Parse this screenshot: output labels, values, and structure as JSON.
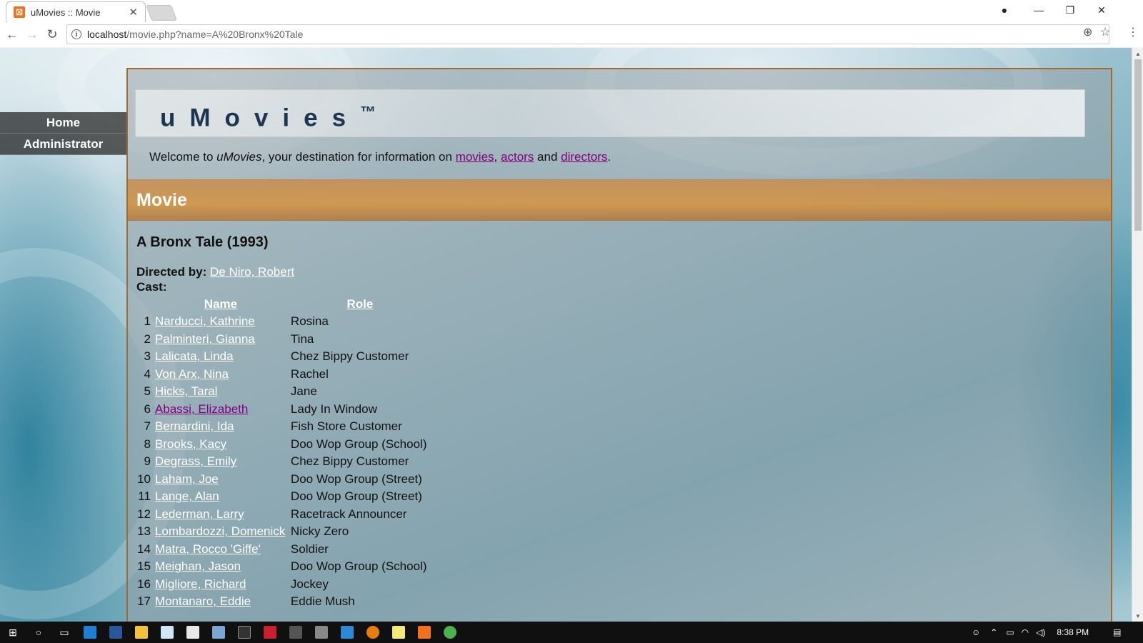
{
  "browser": {
    "tab_title": "uMovies :: Movie",
    "tab_favicon": "xampp-icon",
    "url_host": "localhost",
    "url_path": "/movie.php?name=A%20Bronx%20Tale"
  },
  "sidebar": {
    "items": [
      {
        "label": "Home"
      },
      {
        "label": "Administrator"
      }
    ]
  },
  "banner": {
    "logo": "uMovies",
    "tm": "™"
  },
  "welcome": {
    "prefix": "Welcome to ",
    "brand": "uMovies",
    "middle": ", your destination for information on ",
    "link_movies": "movies",
    "comma": ",",
    "link_actors": "actors",
    "and": " and ",
    "link_directors": "directors",
    "suffix": "."
  },
  "section": {
    "heading": "Movie"
  },
  "movie": {
    "title": "A Bronx Tale (1993)",
    "directed_by_label": "Directed by:",
    "director": "De Niro, Robert",
    "cast_label": "Cast:",
    "columns": {
      "name": "Name",
      "role": "Role"
    },
    "cast": [
      {
        "n": "1",
        "name": "Narducci, Kathrine",
        "role": "Rosina"
      },
      {
        "n": "2",
        "name": "Palminteri, Gianna",
        "role": "Tina"
      },
      {
        "n": "3",
        "name": "Lalicata, Linda",
        "role": "Chez Bippy Customer"
      },
      {
        "n": "4",
        "name": "Von Arx, Nina",
        "role": "Rachel"
      },
      {
        "n": "5",
        "name": "Hicks, Taral",
        "role": "Jane"
      },
      {
        "n": "6",
        "name": "Abassi, Elizabeth",
        "role": "Lady In Window",
        "visited": true
      },
      {
        "n": "7",
        "name": "Bernardini, Ida",
        "role": "Fish Store Customer"
      },
      {
        "n": "8",
        "name": "Brooks, Kacy",
        "role": "Doo Wop Group (School)"
      },
      {
        "n": "9",
        "name": "Degrass, Emily",
        "role": "Chez Bippy Customer"
      },
      {
        "n": "10",
        "name": "Laham, Joe",
        "role": "Doo Wop Group (Street)"
      },
      {
        "n": "11",
        "name": "Lange, Alan",
        "role": "Doo Wop Group (Street)"
      },
      {
        "n": "12",
        "name": "Lederman, Larry",
        "role": "Racetrack Announcer"
      },
      {
        "n": "13",
        "name": "Lombardozzi, Domenick",
        "role": "Nicky Zero"
      },
      {
        "n": "14",
        "name": "Matra, Rocco 'Giffe'",
        "role": "Soldier"
      },
      {
        "n": "15",
        "name": "Meighan, Jason",
        "role": "Doo Wop Group (School)"
      },
      {
        "n": "16",
        "name": "Migliore, Richard",
        "role": "Jockey"
      },
      {
        "n": "17",
        "name": "Montanaro, Eddie",
        "role": "Eddie Mush"
      }
    ]
  },
  "taskbar": {
    "time": "8:38 PM"
  },
  "colors": {
    "accent_border": "#a26a2c",
    "visited_link": "#800080",
    "logo_text": "#1e3550"
  }
}
